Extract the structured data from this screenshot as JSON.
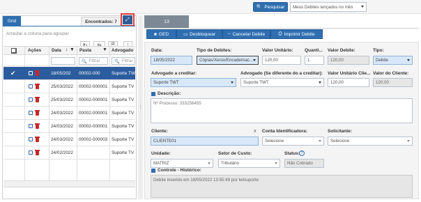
{
  "toolbar": {
    "pesquisar_label": "Pesquisar",
    "filter_select": "Meus Debites lançados no mês"
  },
  "left": {
    "grid_tab": "Grid",
    "encontrados": "Encontrados: 7",
    "group_placeholder": "Arrastar a coluna para agrupar",
    "columns": [
      "Ações",
      "Data",
      "Pasta",
      "Advogado"
    ],
    "filter_placeholder": "Filtrar",
    "rows": [
      {
        "data": "18/05/202",
        "pasta": "00002-000",
        "adv": "Suporte TW",
        "selected": true
      },
      {
        "data": "25/03/2022",
        "pasta": "00002-000001",
        "adv": "Suporte TV",
        "selected": false
      },
      {
        "data": "25/03/2022",
        "pasta": "00002-000001",
        "adv": "Suporte TV",
        "selected": false
      },
      {
        "data": "24/03/2022",
        "pasta": "00002-000001",
        "adv": "Suporte TV",
        "selected": false
      },
      {
        "data": "24/03/2022",
        "pasta": "00002-000001",
        "adv": "Suporte TV",
        "selected": false
      },
      {
        "data": "24/03/2022",
        "pasta": "00002-000003",
        "adv": "Suporte TV",
        "selected": false
      },
      {
        "data": "24/02/2022",
        "pasta": "",
        "adv": "Suporte TV",
        "selected": false
      }
    ]
  },
  "right": {
    "tab_label": "13",
    "actions": {
      "ged": "GED",
      "desbloquear": "Desbloquear",
      "cancelar": "Cancelar Debite",
      "imprimir": "Imprimir Debite"
    },
    "form": {
      "data_label": "Data:",
      "data_value": "18/05/2022",
      "tipo_debites_label": "Tipo de Debites:",
      "tipo_debites_value": "Cópias/Xerox/Encadernac...",
      "valor_unitario_label": "Valor Unitário:",
      "valor_unitario_value": "120,00",
      "quantidade_label": "Quanti...",
      "quantidade_value": "1",
      "valor_debite_label": "Valor Debite:",
      "valor_debite_value": "120,00",
      "tipo_label": "Tipo:",
      "tipo_value": "Debite",
      "advogado_creditar_label": "Advogado a creditar:",
      "advogado_creditar_value": "Suporte TWT",
      "advogado_diferente_label": "Advogado (Se diferente do a creditar):",
      "advogado_diferente_value": "Suporte TWT",
      "valor_unit_cliente_label": "Valor Unitário Clie...",
      "valor_unit_cliente_value": "120,00",
      "valor_cliente_label": "Valor do Cliente:",
      "valor_cliente_value": "120,00",
      "descricao_label": "Descrição:",
      "descricao_value": "Nº Processo: 333256455",
      "cliente_label": "Cliente:",
      "cliente_value": "CLIENTE01",
      "cliente_clear": "x",
      "conta_label": "Conta Identificadora:",
      "conta_value": "Selecione",
      "solicitante_label": "Solicitante:",
      "solicitante_value": "Selecione",
      "unidade_label": "Unidade:",
      "unidade_value": "MATRIZ",
      "setor_label": "Setor de Custo:",
      "setor_value": "Tributário",
      "status_label": "Status:",
      "status_value": "Não Cobrado",
      "historico_label": "Controle - Histórico:",
      "historico_value": "Debite inserido em 18/05/2022 13:55:49 por twtsuporte"
    }
  },
  "colors": {
    "accent": "#2f6fb1",
    "highlight": "#e53935",
    "selected_row": "#2b5c9e"
  }
}
